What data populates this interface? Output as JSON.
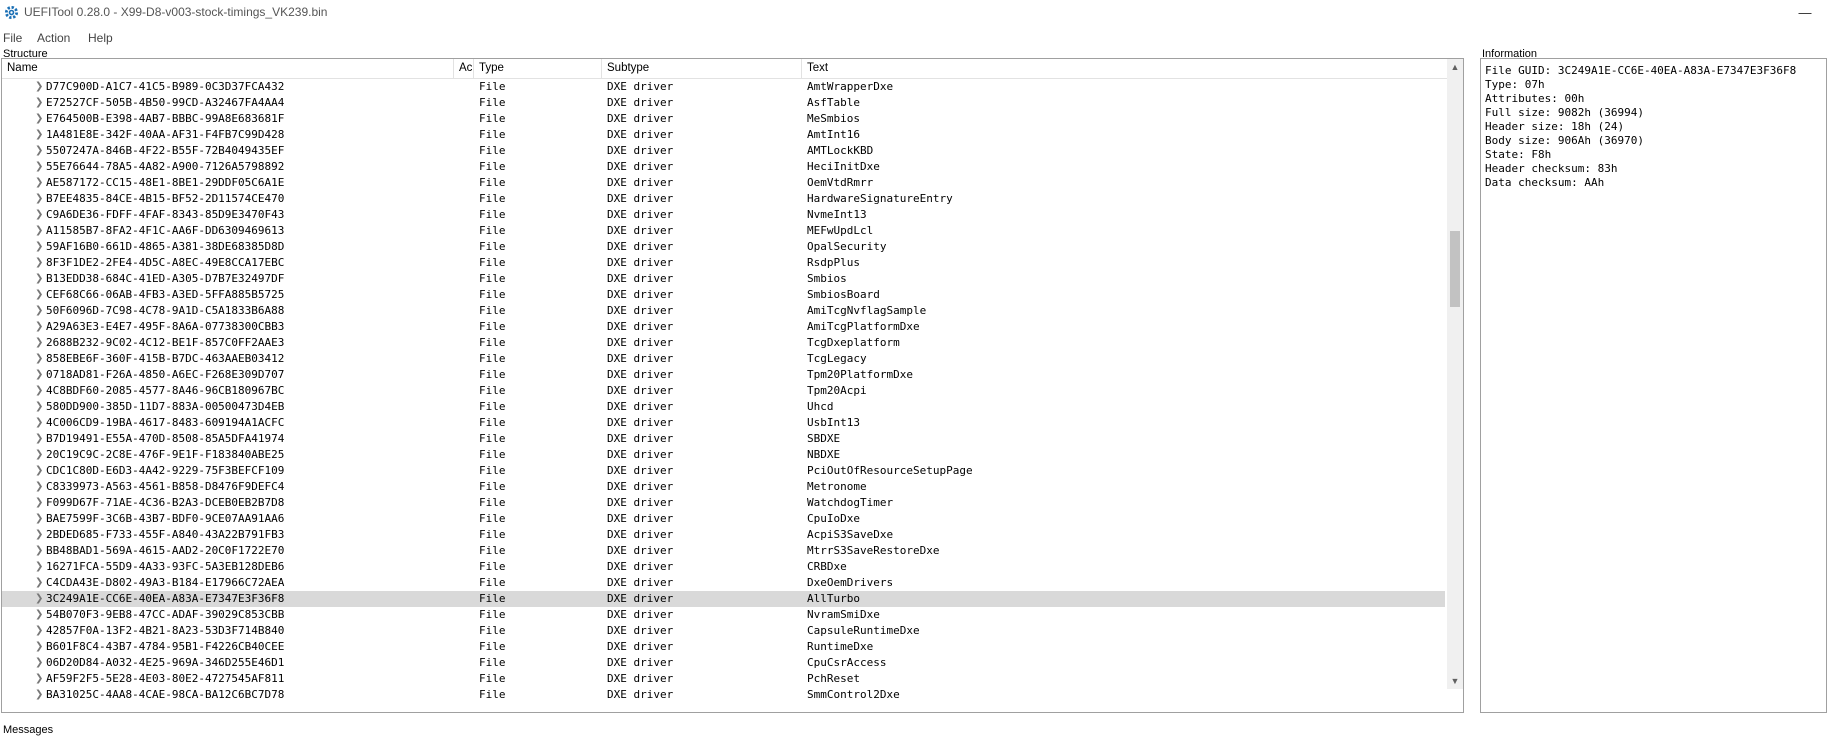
{
  "window": {
    "title": "UEFITool 0.28.0 - X99-D8-v003-stock-timings_VK239.bin"
  },
  "menu": [
    "File",
    "Action",
    "Help"
  ],
  "structure": {
    "label": "Structure",
    "columns": [
      "Name",
      "Ac",
      "Type",
      "Subtype",
      "Text"
    ],
    "rows": [
      {
        "name": "D77C900D-A1C7-41C5-B989-0C3D37FCA432",
        "type": "File",
        "subtype": "DXE driver",
        "text": "AmtWrapperDxe"
      },
      {
        "name": "E72527CF-505B-4B50-99CD-A32467FA4AA4",
        "type": "File",
        "subtype": "DXE driver",
        "text": "AsfTable"
      },
      {
        "name": "E764500B-E398-4AB7-BBBC-99A8E683681F",
        "type": "File",
        "subtype": "DXE driver",
        "text": "MeSmbios"
      },
      {
        "name": "1A481E8E-342F-40AA-AF31-F4FB7C99D428",
        "type": "File",
        "subtype": "DXE driver",
        "text": "AmtInt16"
      },
      {
        "name": "5507247A-846B-4F22-B55F-72B4049435EF",
        "type": "File",
        "subtype": "DXE driver",
        "text": "AMTLockKBD"
      },
      {
        "name": "55E76644-78A5-4A82-A900-7126A5798892",
        "type": "File",
        "subtype": "DXE driver",
        "text": "HeciInitDxe"
      },
      {
        "name": "AE587172-CC15-48E1-8BE1-29DDF05C6A1E",
        "type": "File",
        "subtype": "DXE driver",
        "text": "OemVtdRmrr"
      },
      {
        "name": "B7EE4835-84CE-4B15-BF52-2D11574CE470",
        "type": "File",
        "subtype": "DXE driver",
        "text": "HardwareSignatureEntry"
      },
      {
        "name": "C9A6DE36-FDFF-4FAF-8343-85D9E3470F43",
        "type": "File",
        "subtype": "DXE driver",
        "text": "NvmeInt13"
      },
      {
        "name": "A11585B7-8FA2-4F1C-AA6F-DD6309469613",
        "type": "File",
        "subtype": "DXE driver",
        "text": "MEFwUpdLcl"
      },
      {
        "name": "59AF16B0-661D-4865-A381-38DE68385D8D",
        "type": "File",
        "subtype": "DXE driver",
        "text": "OpalSecurity"
      },
      {
        "name": "8F3F1DE2-2FE4-4D5C-A8EC-49E8CCA17EBC",
        "type": "File",
        "subtype": "DXE driver",
        "text": "RsdpPlus"
      },
      {
        "name": "B13EDD38-684C-41ED-A305-D7B7E32497DF",
        "type": "File",
        "subtype": "DXE driver",
        "text": "Smbios"
      },
      {
        "name": "CEF68C66-06AB-4FB3-A3ED-5FFA885B5725",
        "type": "File",
        "subtype": "DXE driver",
        "text": "SmbiosBoard"
      },
      {
        "name": "50F6096D-7C98-4C78-9A1D-C5A1833B6A88",
        "type": "File",
        "subtype": "DXE driver",
        "text": "AmiTcgNvflagSample"
      },
      {
        "name": "A29A63E3-E4E7-495F-8A6A-07738300CBB3",
        "type": "File",
        "subtype": "DXE driver",
        "text": "AmiTcgPlatformDxe"
      },
      {
        "name": "2688B232-9C02-4C12-BE1F-857C0FF2AAE3",
        "type": "File",
        "subtype": "DXE driver",
        "text": "TcgDxeplatform"
      },
      {
        "name": "858EBE6F-360F-415B-B7DC-463AAEB03412",
        "type": "File",
        "subtype": "DXE driver",
        "text": "TcgLegacy"
      },
      {
        "name": "0718AD81-F26A-4850-A6EC-F268E309D707",
        "type": "File",
        "subtype": "DXE driver",
        "text": "Tpm20PlatformDxe"
      },
      {
        "name": "4C8BDF60-2085-4577-8A46-96CB180967BC",
        "type": "File",
        "subtype": "DXE driver",
        "text": "Tpm20Acpi"
      },
      {
        "name": "580DD900-385D-11D7-883A-00500473D4EB",
        "type": "File",
        "subtype": "DXE driver",
        "text": "Uhcd"
      },
      {
        "name": "4C006CD9-19BA-4617-8483-609194A1ACFC",
        "type": "File",
        "subtype": "DXE driver",
        "text": "UsbInt13"
      },
      {
        "name": "B7D19491-E55A-470D-8508-85A5DFA41974",
        "type": "File",
        "subtype": "DXE driver",
        "text": "SBDXE"
      },
      {
        "name": "20C19C9C-2C8E-476F-9E1F-F183840ABE25",
        "type": "File",
        "subtype": "DXE driver",
        "text": "NBDXE"
      },
      {
        "name": "CDC1C80D-E6D3-4A42-9229-75F3BEFCF109",
        "type": "File",
        "subtype": "DXE driver",
        "text": "PciOutOfResourceSetupPage"
      },
      {
        "name": "C8339973-A563-4561-B858-D8476F9DEFC4",
        "type": "File",
        "subtype": "DXE driver",
        "text": "Metronome"
      },
      {
        "name": "F099D67F-71AE-4C36-B2A3-DCEB0EB2B7D8",
        "type": "File",
        "subtype": "DXE driver",
        "text": "WatchdogTimer"
      },
      {
        "name": "BAE7599F-3C6B-43B7-BDF0-9CE07AA91AA6",
        "type": "File",
        "subtype": "DXE driver",
        "text": "CpuIoDxe"
      },
      {
        "name": "2BDED685-F733-455F-A840-43A22B791FB3",
        "type": "File",
        "subtype": "DXE driver",
        "text": "AcpiS3SaveDxe"
      },
      {
        "name": "BB48BAD1-569A-4615-AAD2-20C0F1722E70",
        "type": "File",
        "subtype": "DXE driver",
        "text": "MtrrS3SaveRestoreDxe"
      },
      {
        "name": "16271FCA-55D9-4A33-93FC-5A3EB128DEB6",
        "type": "File",
        "subtype": "DXE driver",
        "text": "CRBDxe"
      },
      {
        "name": "C4CDA43E-D802-49A3-B184-E17966C72AEA",
        "type": "File",
        "subtype": "DXE driver",
        "text": "DxeOemDrivers"
      },
      {
        "name": "3C249A1E-CC6E-40EA-A83A-E7347E3F36F8",
        "type": "File",
        "subtype": "DXE driver",
        "text": "AllTurbo",
        "selected": true
      },
      {
        "name": "54B070F3-9EB8-47CC-ADAF-39029C853CBB",
        "type": "File",
        "subtype": "DXE driver",
        "text": "NvramSmiDxe"
      },
      {
        "name": "42857F0A-13F2-4B21-8A23-53D3F714B840",
        "type": "File",
        "subtype": "DXE driver",
        "text": "CapsuleRuntimeDxe"
      },
      {
        "name": "B601F8C4-43B7-4784-95B1-F4226CB40CEE",
        "type": "File",
        "subtype": "DXE driver",
        "text": "RuntimeDxe"
      },
      {
        "name": "06D20D84-A032-4E25-969A-346D255E46D1",
        "type": "File",
        "subtype": "DXE driver",
        "text": "CpuCsrAccess"
      },
      {
        "name": "AF59F2F5-5E28-4E03-80E2-4727545AF811",
        "type": "File",
        "subtype": "DXE driver",
        "text": "PchReset"
      },
      {
        "name": "BA31025C-4AA8-4CAE-98CA-BA12C6BC7D78",
        "type": "File",
        "subtype": "DXE driver",
        "text": "SmmControl2Dxe"
      }
    ]
  },
  "information": {
    "label": "Information",
    "lines": [
      "File GUID: 3C249A1E-CC6E-40EA-A83A-E7347E3F36F8",
      "Type: 07h",
      "Attributes: 00h",
      "Full size: 9082h (36994)",
      "Header size: 18h (24)",
      "Body size: 906Ah (36970)",
      "State: F8h",
      "Header checksum: 83h",
      "Data checksum: AAh"
    ]
  },
  "messages": {
    "label": "Messages"
  },
  "icons": {
    "app": "gear-icon",
    "expand": "chevron-right-icon",
    "scroll_up": "scroll-up-icon",
    "scroll_down": "scroll-down-icon",
    "minimize": "minimize-icon"
  },
  "colors": {
    "selection": "#d9d9d9",
    "border": "#a0a0a0"
  }
}
